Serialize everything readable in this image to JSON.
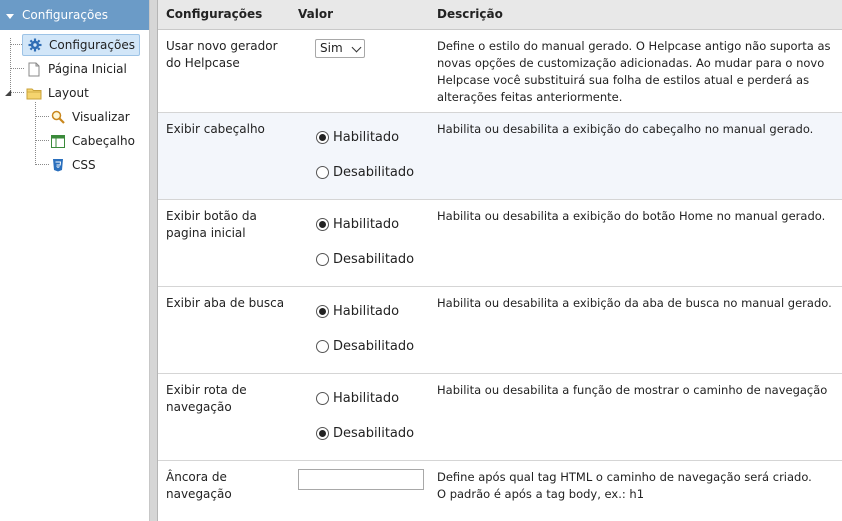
{
  "sidebar": {
    "header": "Configurações",
    "items": [
      {
        "label": "Configurações",
        "icon": "gear-icon"
      },
      {
        "label": "Página Inicial",
        "icon": "page-icon"
      },
      {
        "label": "Layout",
        "icon": "folder-icon"
      },
      {
        "label": "Visualizar",
        "icon": "magnifier-icon"
      },
      {
        "label": "Cabeçalho",
        "icon": "table-icon"
      },
      {
        "label": "CSS",
        "icon": "css-icon"
      }
    ]
  },
  "table": {
    "headers": {
      "name": "Configurações",
      "value": "Valor",
      "desc": "Descrição"
    },
    "rows": [
      {
        "name": "Usar novo gerador do Helpcase",
        "select_value": "Sim",
        "desc": "Define o estilo do manual gerado. O Helpcase antigo não suporta as novas opções de customização adicionadas. Ao mudar para o novo Helpcase você substituirá sua folha de estilos atual e perderá as alterações feitas anteriormente."
      },
      {
        "name": "Exibir cabeçalho",
        "opt1": "Habilitado",
        "opt2": "Desabilitado",
        "selected": "Habilitado",
        "desc": "Habilita ou desabilita a exibição do cabeçalho no manual gerado."
      },
      {
        "name": "Exibir botão da pagina inicial",
        "opt1": "Habilitado",
        "opt2": "Desabilitado",
        "selected": "Habilitado",
        "desc": "Habilita ou desabilita a exibição do botão Home no manual gerado."
      },
      {
        "name": "Exibir aba de busca",
        "opt1": "Habilitado",
        "opt2": "Desabilitado",
        "selected": "Habilitado",
        "desc": "Habilita ou desabilita a exibição da aba de busca no manual gerado."
      },
      {
        "name": "Exibir rota de navegação",
        "opt1": "Habilitado",
        "opt2": "Desabilitado",
        "selected": "Desabilitado",
        "desc": "Habilita ou desabilita a função de mostrar o caminho de navegação"
      },
      {
        "name": "Âncora de navegação",
        "input_value": "",
        "desc_line1": "Define após qual tag HTML o caminho de navegação será criado.",
        "desc_line2": "O padrão é após a tag body, ex.: h1"
      }
    ]
  },
  "colors": {
    "sidebar_header": "#6b9bc7",
    "selected_bg": "#d2e6f8",
    "table_header": "#e8e8e8"
  }
}
